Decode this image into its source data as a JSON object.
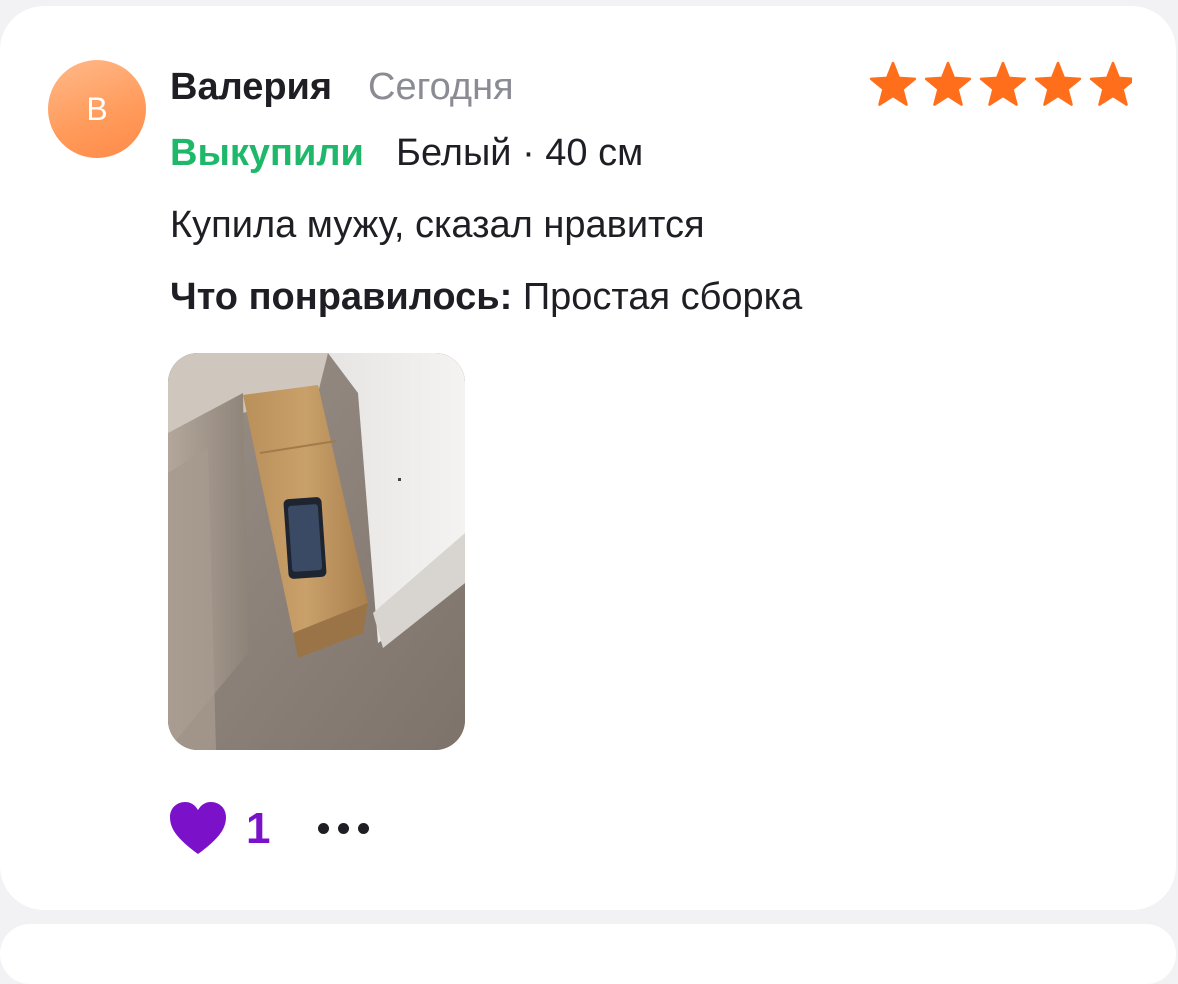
{
  "review": {
    "avatar_letter": "В",
    "author": "Валерия",
    "date": "Сегодня",
    "rating": 5,
    "status": "Выкупили",
    "variant": "Белый · 40 см",
    "text": "Купила мужу, сказал нравится",
    "likes_label": "Что понравилось:",
    "likes_value": "Простая сборка",
    "photo_icon": "review-photo-boxed-product",
    "like_count": "1",
    "heart_icon": "heart-icon",
    "more_icon": "more-dots-icon"
  },
  "colors": {
    "accent_orange": "#ff6e1a",
    "status_green": "#1fb86a",
    "heart_purple": "#7b12c9",
    "text_dark": "#1e1e24",
    "text_muted": "#8b8b94"
  }
}
